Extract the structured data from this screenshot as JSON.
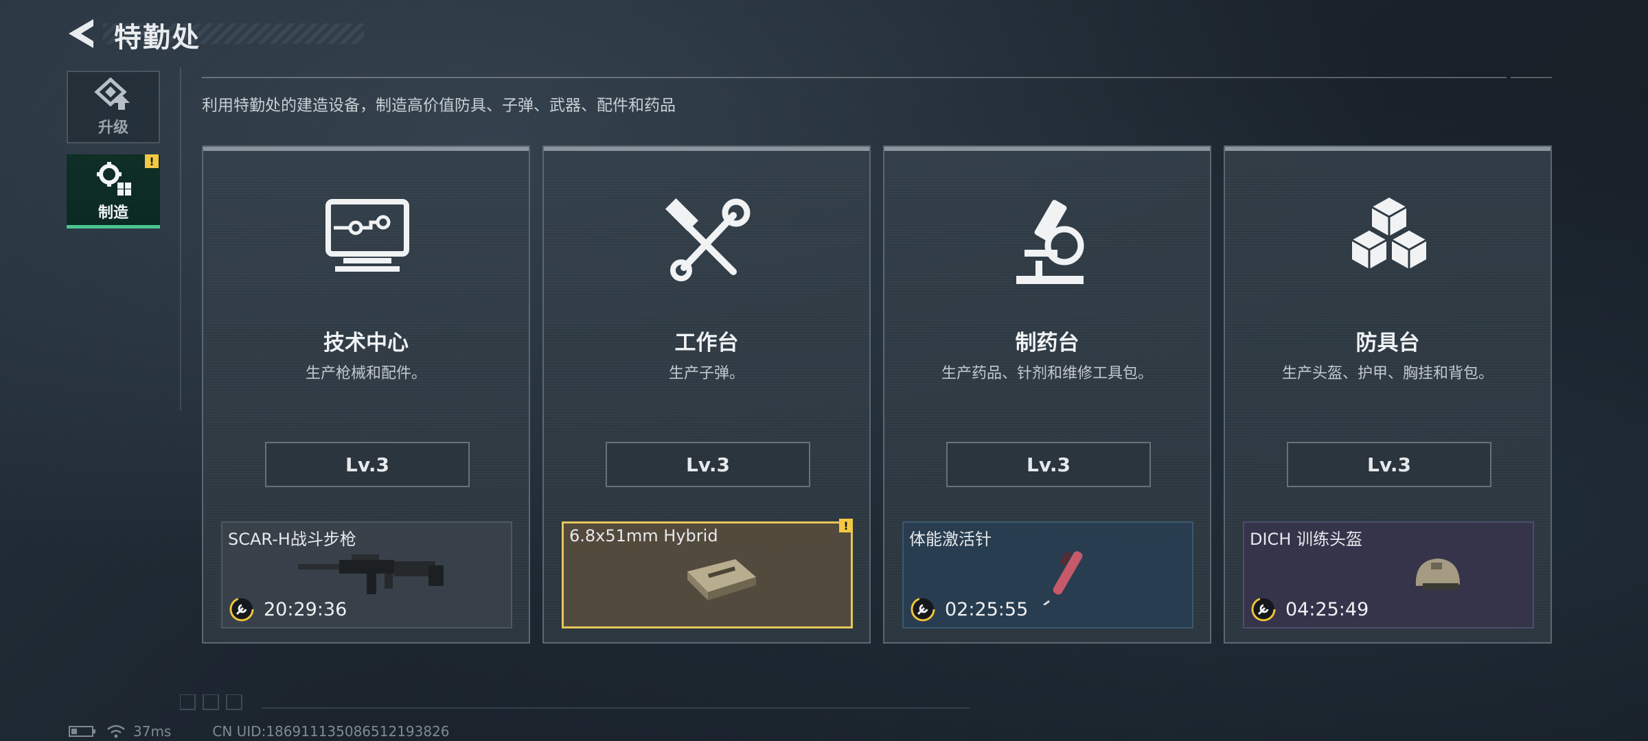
{
  "header": {
    "title": "特勤处"
  },
  "tabs": [
    {
      "label": "升级",
      "icon": "upgrade-icon"
    },
    {
      "label": "制造",
      "icon": "gear-icon",
      "badge": "!"
    }
  ],
  "description": "利用特勤处的建造设备，制造高价值防具、子弹、武器、配件和药品",
  "cards": [
    {
      "name": "技术中心",
      "desc": "生产枪械和配件。",
      "level": "Lv.3",
      "icon": "monitor-icon",
      "item": {
        "name": "SCAR-H战斗步枪",
        "timer": "20:29:36",
        "image": "rifle"
      }
    },
    {
      "name": "工作台",
      "desc": "生产子弹。",
      "level": "Lv.3",
      "icon": "hammer-wrench-icon",
      "item": {
        "name": "6.8x51mm Hybrid",
        "timer": "",
        "image": "ammo-box",
        "badge": "!"
      }
    },
    {
      "name": "制药台",
      "desc": "生产药品、针剂和维修工具包。",
      "level": "Lv.3",
      "icon": "microscope-icon",
      "item": {
        "name": "体能激活针",
        "timer": "02:25:55",
        "image": "syringe"
      }
    },
    {
      "name": "防具台",
      "desc": "生产头盔、护甲、胸挂和背包。",
      "level": "Lv.3",
      "icon": "blocks-icon",
      "item": {
        "name": "DICH 训练头盔",
        "timer": "04:25:49",
        "image": "helmet"
      }
    }
  ],
  "status": {
    "ping": "37ms",
    "uid": "CN UID:186911135086512193826"
  },
  "colors": {
    "accent_green": "#49c78f",
    "warning": "#f3c843",
    "timer_ring": "#f0c43a"
  }
}
